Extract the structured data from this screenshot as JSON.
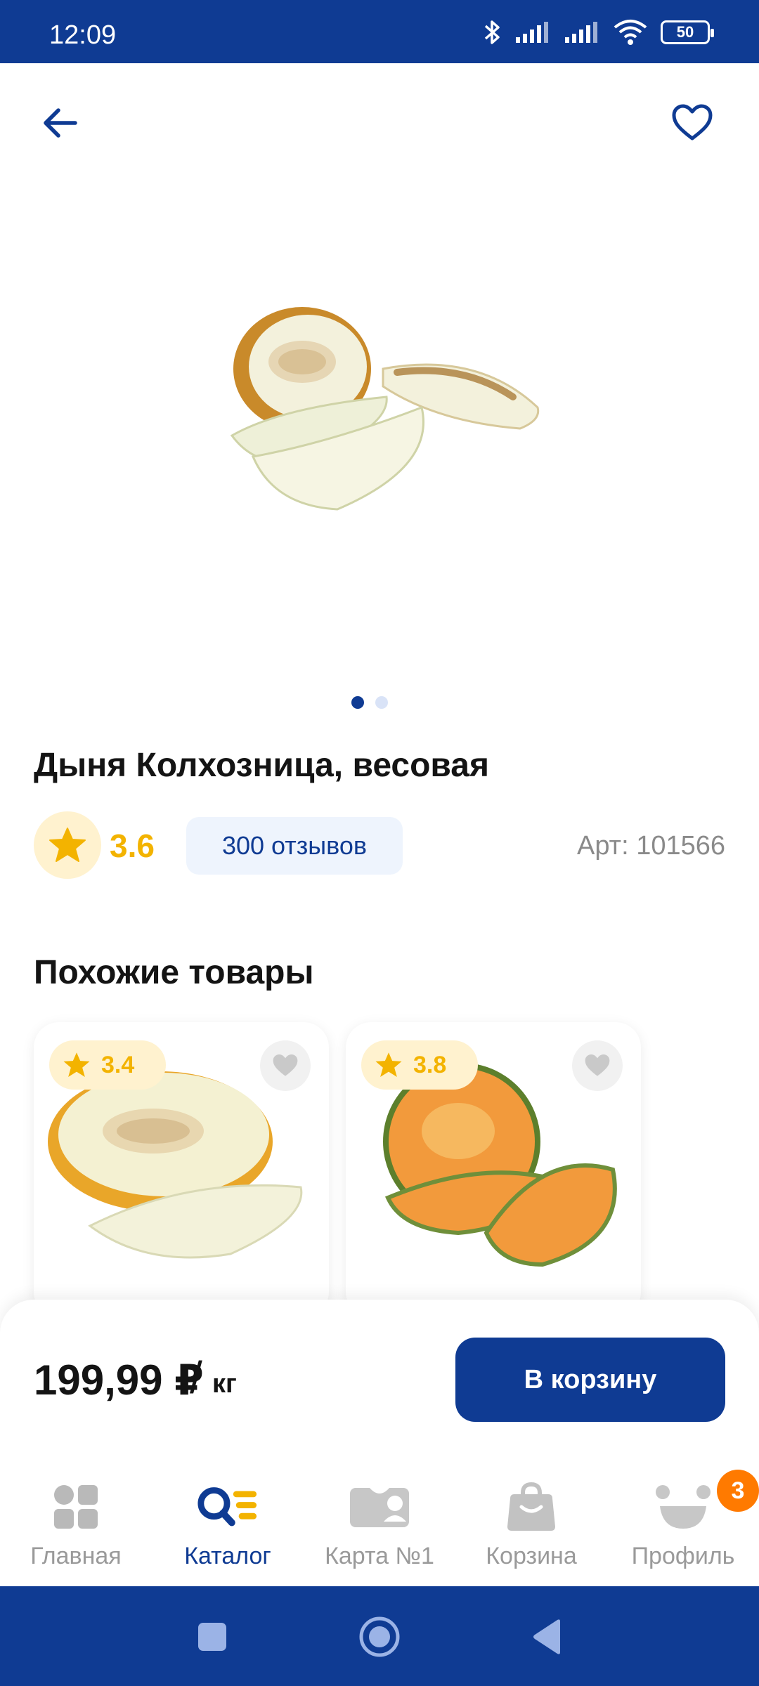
{
  "status_bar": {
    "time": "12:09",
    "battery": "50"
  },
  "header": {
    "back_icon": "arrow-left-icon",
    "favorite_icon": "heart-outline-icon"
  },
  "product": {
    "title": "Дыня Колхозница, весовая",
    "rating": "3.6",
    "reviews_label": "300 отзывов",
    "sku": "Арт: 101566",
    "image_count": 2,
    "current_image": 1
  },
  "similar": {
    "title": "Похожие товары",
    "items": [
      {
        "rating": "3.4"
      },
      {
        "rating": "3.8"
      }
    ]
  },
  "purchase": {
    "price": "199,99 ₽",
    "separator": "/",
    "unit": "кг",
    "button_label": "В корзину"
  },
  "tabs": [
    {
      "label": "Главная",
      "icon": "home-grid-icon",
      "active": false
    },
    {
      "label": "Каталог",
      "icon": "catalog-search-icon",
      "active": true
    },
    {
      "label": "Карта №1",
      "icon": "loyalty-card-icon",
      "active": false
    },
    {
      "label": "Корзина",
      "icon": "shopping-bag-icon",
      "active": false
    },
    {
      "label": "Профиль",
      "icon": "profile-face-icon",
      "active": false
    }
  ],
  "profile_badge": "3",
  "colors": {
    "brand": "#0f3b93",
    "accent_yellow": "#f3b300",
    "badge_orange": "#ff7a00"
  }
}
